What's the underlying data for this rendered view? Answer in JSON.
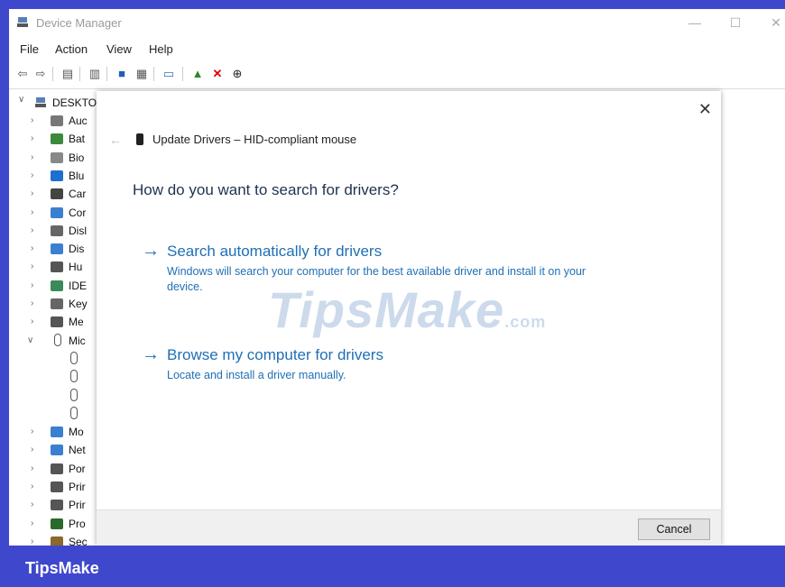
{
  "window": {
    "title": "Device Manager",
    "minimize": "—",
    "maximize": "☐",
    "close": "✕"
  },
  "menu": [
    "File",
    "Action",
    "View",
    "Help"
  ],
  "tree": {
    "root": "DESKTO",
    "items": [
      {
        "label": "Auc",
        "icon": "speaker-icon",
        "expanded": false
      },
      {
        "label": "Bat",
        "icon": "battery-icon",
        "expanded": false
      },
      {
        "label": "Bio",
        "icon": "biometric-icon",
        "expanded": false
      },
      {
        "label": "Blu",
        "icon": "bluetooth-icon",
        "expanded": false
      },
      {
        "label": "Car",
        "icon": "camera-icon",
        "expanded": false
      },
      {
        "label": "Cor",
        "icon": "computer-icon",
        "expanded": false
      },
      {
        "label": "Disl",
        "icon": "disk-drive-icon",
        "expanded": false
      },
      {
        "label": "Dis",
        "icon": "display-icon",
        "expanded": false
      },
      {
        "label": "Hu",
        "icon": "hid-icon",
        "expanded": false
      },
      {
        "label": "IDE",
        "icon": "ide-icon",
        "expanded": false
      },
      {
        "label": "Key",
        "icon": "keyboard-icon",
        "expanded": false
      },
      {
        "label": "Me",
        "icon": "memory-icon",
        "expanded": false
      },
      {
        "label": "Mic",
        "icon": "mouse-icon",
        "expanded": true
      },
      {
        "label": "",
        "icon": "mouse-icon",
        "child": true
      },
      {
        "label": "",
        "icon": "mouse-icon",
        "child": true
      },
      {
        "label": "",
        "icon": "mouse-icon",
        "child": true
      },
      {
        "label": "",
        "icon": "mouse-icon",
        "child": true
      },
      {
        "label": "Mo",
        "icon": "monitor-icon",
        "expanded": false
      },
      {
        "label": "Net",
        "icon": "network-icon",
        "expanded": false
      },
      {
        "label": "Por",
        "icon": "port-icon",
        "expanded": false
      },
      {
        "label": "Prir",
        "icon": "printer-icon",
        "expanded": false
      },
      {
        "label": "Prir",
        "icon": "printer-icon",
        "expanded": false
      },
      {
        "label": "Pro",
        "icon": "processor-icon",
        "expanded": false
      },
      {
        "label": "Sec",
        "icon": "security-icon",
        "expanded": false
      }
    ]
  },
  "dialog": {
    "close": "✕",
    "back": "←",
    "title": "Update Drivers – HID-compliant mouse",
    "question": "How do you want to search for drivers?",
    "options": [
      {
        "arrow": "→",
        "title": "Search automatically for drivers",
        "desc": "Windows will search your computer for the best available driver and install it on your device."
      },
      {
        "arrow": "→",
        "title": "Browse my computer for drivers",
        "desc": "Locate and install a driver manually."
      }
    ],
    "cancel": "Cancel"
  },
  "watermark": {
    "main": "TipsMake",
    "suffix": ".com"
  },
  "brand": "TipsMake"
}
